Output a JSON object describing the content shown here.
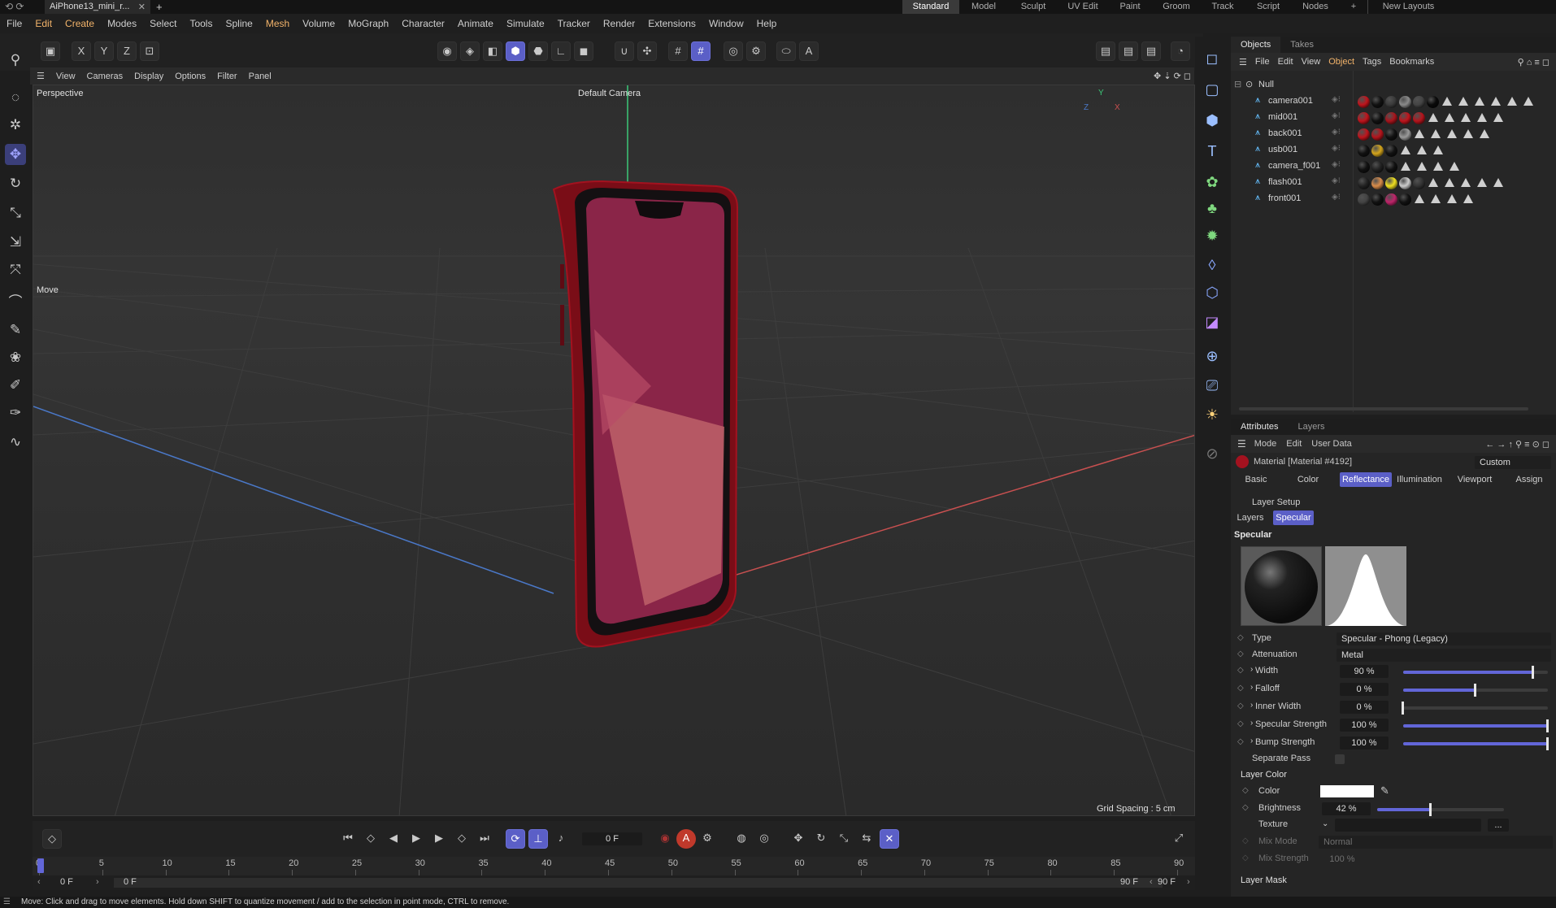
{
  "titlebar": {
    "doc_tab": "AiPhone13_mini_r...",
    "layouts": [
      "Standard",
      "Model",
      "Sculpt",
      "UV Edit",
      "Paint",
      "Groom",
      "Track",
      "Script",
      "Nodes"
    ],
    "active_layout": "Standard",
    "new_layouts": "New Layouts"
  },
  "menubar": [
    "File",
    "Edit",
    "Create",
    "Modes",
    "Select",
    "Tools",
    "Spline",
    "Mesh",
    "Volume",
    "MoGraph",
    "Character",
    "Animate",
    "Simulate",
    "Tracker",
    "Render",
    "Extensions",
    "Window",
    "Help"
  ],
  "axis_buttons": [
    "X",
    "Y",
    "Z"
  ],
  "viewport": {
    "menu": [
      "View",
      "Cameras",
      "Display",
      "Options",
      "Filter",
      "Panel"
    ],
    "projection": "Perspective",
    "camera": "Default Camera",
    "tool_hint": "Move",
    "grid_spacing": "Grid Spacing : 5 cm",
    "axis_labels": {
      "y": "Y",
      "z": "Z",
      "x": "X"
    }
  },
  "objects_panel": {
    "tabs": [
      "Objects",
      "Takes"
    ],
    "menu": [
      "File",
      "Edit",
      "View",
      "Object",
      "Tags",
      "Bookmarks"
    ],
    "root": "Null",
    "items": [
      {
        "name": "camera001",
        "mats": [
          "#c0141c",
          "#111",
          "#3a3a3a",
          "#8a8a8a",
          "#444",
          "#0a0a0a"
        ],
        "tris": 6
      },
      {
        "name": "mid001",
        "mats": [
          "#c0141c",
          "#111",
          "#a8141c",
          "#c0141c",
          "#b5141c"
        ],
        "tris": 5
      },
      {
        "name": "back001",
        "mats": [
          "#c0141c",
          "#b5141c",
          "#111",
          "#9a9a9a"
        ],
        "tris": 5
      },
      {
        "name": "usb001",
        "mats": [
          "#111",
          "#d4a51c",
          "#111"
        ],
        "tris": 3
      },
      {
        "name": "camera_f001",
        "mats": [
          "#111",
          "#222",
          "#111"
        ],
        "tris": 4
      },
      {
        "name": "flash001",
        "mats": [
          "#222",
          "#d98c4a",
          "#f0e020",
          "#cccccc",
          "#333"
        ],
        "tris": 5
      },
      {
        "name": "front001",
        "mats": [
          "#444",
          "#111",
          "#c0246a",
          "#111"
        ],
        "tris": 4
      }
    ]
  },
  "attributes": {
    "tabs": [
      "Attributes",
      "Layers"
    ],
    "menu": [
      "Mode",
      "Edit",
      "User Data"
    ],
    "material_title": "Material [Material #4192]",
    "custom": "Custom",
    "channel_tabs": [
      "Basic",
      "Color",
      "Reflectance",
      "Illumination",
      "Viewport",
      "Assign"
    ],
    "active_channel": "Reflectance",
    "layer_setup": "Layer Setup",
    "layer_tabs": [
      "Layers",
      "Specular"
    ],
    "active_layer": "Specular",
    "section": "Specular",
    "type_label": "Type",
    "type_value": "Specular - Phong (Legacy)",
    "attenuation_label": "Attenuation",
    "attenuation_value": "Metal",
    "params": [
      {
        "label": "Width",
        "value": "90 %",
        "fill": 0.9
      },
      {
        "label": "Falloff",
        "value": "0 %",
        "fill": 0.5
      },
      {
        "label": "Inner Width",
        "value": "0 %",
        "fill": 0.0
      },
      {
        "label": "Specular Strength",
        "value": "100 %",
        "fill": 1.0
      },
      {
        "label": "Bump Strength",
        "value": "100 %",
        "fill": 1.0
      }
    ],
    "separate_pass": "Separate Pass",
    "layer_color_section": "Layer Color",
    "color_label": "Color",
    "brightness_label": "Brightness",
    "brightness_value": "42 %",
    "brightness_fill": 0.42,
    "texture_label": "Texture",
    "texture_btn": "...",
    "mix_mode_label": "Mix Mode",
    "mix_mode_value": "Normal",
    "mix_strength_label": "Mix Strength",
    "mix_strength_value": "100 %",
    "layer_mask_section": "Layer Mask"
  },
  "timeline": {
    "current_frame": "0 F",
    "ticks": [
      "0",
      "5",
      "10",
      "15",
      "20",
      "25",
      "30",
      "35",
      "40",
      "45",
      "50",
      "55",
      "60",
      "65",
      "70",
      "75",
      "80",
      "85",
      "90"
    ],
    "start": "0 F",
    "range_start": "0 F",
    "range_end": "90 F",
    "end": "90 F"
  },
  "status": "Move: Click and drag to move elements. Hold down SHIFT to quantize movement / add to the selection in point mode, CTRL to remove.",
  "colors": {
    "accent": "#5b5fc7",
    "phone_red": "#8e0f1e",
    "grid_x": "#c85050",
    "grid_z": "#4a78c8",
    "grid_y": "#3cc878"
  }
}
